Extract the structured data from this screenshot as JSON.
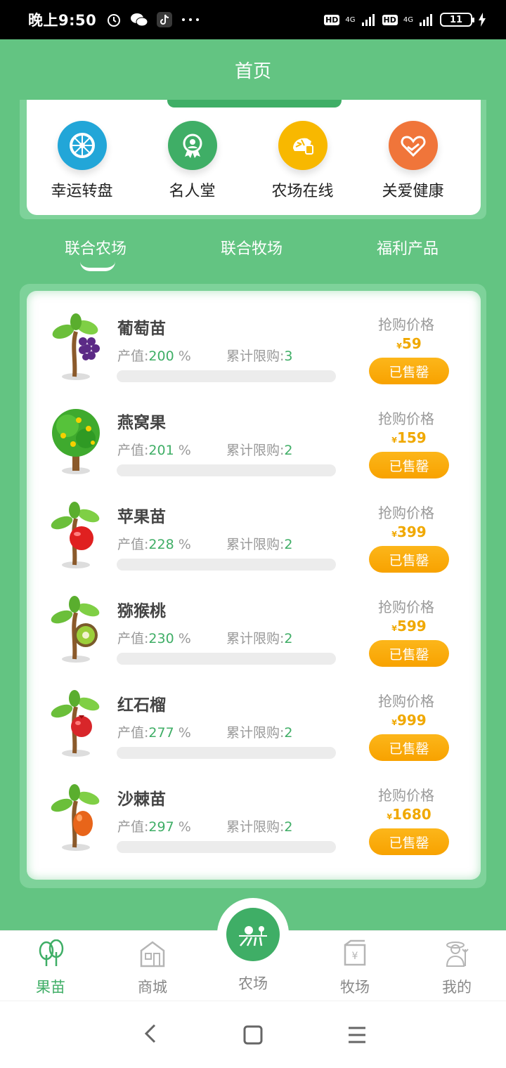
{
  "status_bar": {
    "time": "晚上9:50",
    "icons": [
      "alarm-icon",
      "wechat-icon",
      "tiktok-icon",
      "more-dots-icon"
    ],
    "hd1": "HD",
    "sig1": "4G",
    "hd2": "HD",
    "sig2": "4G",
    "battery": "11"
  },
  "header": {
    "title": "首页"
  },
  "quick_actions": [
    {
      "label": "幸运转盘",
      "icon": "wheel-icon",
      "color": "#22a6d8"
    },
    {
      "label": "名人堂",
      "icon": "award-icon",
      "color": "#3fae66"
    },
    {
      "label": "农场在线",
      "icon": "farm-online-icon",
      "color": "#f8b800"
    },
    {
      "label": "关爱健康",
      "icon": "heart-hand-icon",
      "color": "#f0753a"
    }
  ],
  "tabs": [
    {
      "label": "联合农场",
      "active": true
    },
    {
      "label": "联合牧场",
      "active": false
    },
    {
      "label": "福利产品",
      "active": false
    }
  ],
  "products": [
    {
      "name": "葡萄苗",
      "yield_label": "产值:",
      "yield_value": "200",
      "yield_unit": "%",
      "limit_label": "累计限购:",
      "limit_value": "3",
      "price_label": "抢购价格",
      "currency": "¥",
      "price": "59",
      "button": "已售罄",
      "fruit": "grape",
      "progress": 0
    },
    {
      "name": "燕窝果",
      "yield_label": "产值:",
      "yield_value": "201",
      "yield_unit": "%",
      "limit_label": "累计限购:",
      "limit_value": "2",
      "price_label": "抢购价格",
      "currency": "¥",
      "price": "159",
      "button": "已售罄",
      "fruit": "pitaya",
      "progress": 0
    },
    {
      "name": "苹果苗",
      "yield_label": "产值:",
      "yield_value": "228",
      "yield_unit": "%",
      "limit_label": "累计限购:",
      "limit_value": "2",
      "price_label": "抢购价格",
      "currency": "¥",
      "price": "399",
      "button": "已售罄",
      "fruit": "apple",
      "progress": 0
    },
    {
      "name": "猕猴桃",
      "yield_label": "产值:",
      "yield_value": "230",
      "yield_unit": "%",
      "limit_label": "累计限购:",
      "limit_value": "2",
      "price_label": "抢购价格",
      "currency": "¥",
      "price": "599",
      "button": "已售罄",
      "fruit": "kiwi",
      "progress": 0
    },
    {
      "name": "红石榴",
      "yield_label": "产值:",
      "yield_value": "277",
      "yield_unit": "%",
      "limit_label": "累计限购:",
      "limit_value": "2",
      "price_label": "抢购价格",
      "currency": "¥",
      "price": "999",
      "button": "已售罄",
      "fruit": "pomegranate",
      "progress": 0
    },
    {
      "name": "沙棘苗",
      "yield_label": "产值:",
      "yield_value": "297",
      "yield_unit": "%",
      "limit_label": "累计限购:",
      "limit_value": "2",
      "price_label": "抢购价格",
      "currency": "¥",
      "price": "1680",
      "button": "已售罄",
      "fruit": "seabuckthorn",
      "progress": 0
    }
  ],
  "bottom_nav": [
    {
      "label": "果苗",
      "icon": "tree-icon",
      "active": true
    },
    {
      "label": "商城",
      "icon": "store-icon",
      "active": false
    },
    {
      "label": "农场",
      "icon": "farm-icon",
      "active": false
    },
    {
      "label": "牧场",
      "icon": "ranch-icon",
      "active": false
    },
    {
      "label": "我的",
      "icon": "farmer-icon",
      "active": false
    }
  ],
  "system_nav": {
    "back": "back-icon",
    "home": "home-icon",
    "menu": "menu-icon"
  },
  "colors": {
    "primary": "#63c482",
    "accent": "#3fae66",
    "price": "#f0a800",
    "button": "#f8a200"
  }
}
